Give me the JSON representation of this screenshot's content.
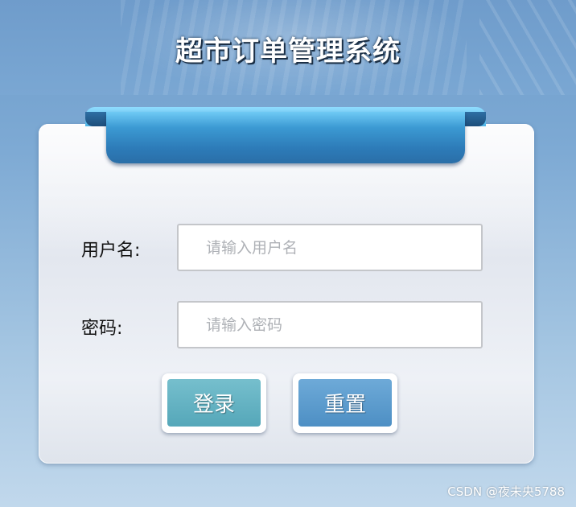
{
  "header": {
    "title": "超市订单管理系统"
  },
  "form": {
    "username": {
      "label": "用户名:",
      "placeholder": "请输入用户名",
      "value": ""
    },
    "password": {
      "label": "密码:",
      "placeholder": "请输入密码",
      "value": ""
    },
    "buttons": {
      "login_label": "登录",
      "reset_label": "重置"
    }
  },
  "watermark": {
    "text": "CSDN @夜未央5788"
  },
  "colors": {
    "ribbon": "#3c9ad3",
    "login_button": "#5fb0c1",
    "reset_button": "#5a9bcd",
    "background": "#7eaad4"
  }
}
